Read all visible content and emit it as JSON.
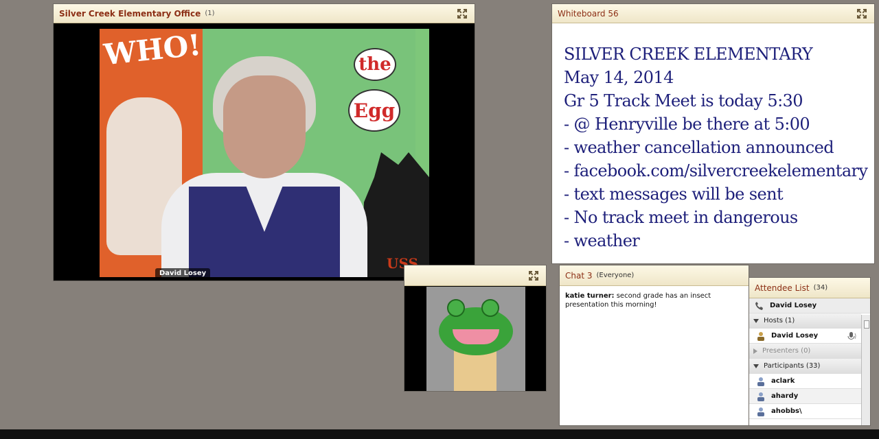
{
  "camera_pod": {
    "title": "Silver Creek Elementary Office",
    "count": "(1)",
    "speaker_name": "David Losey",
    "video_text_who": "WHO!",
    "video_text_the": "the",
    "video_text_egg": "Egg",
    "video_text_uss": "USS"
  },
  "whiteboard": {
    "title": "Whiteboard 56",
    "lines": [
      "SILVER CREEK ELEMENTARY",
      "May 14, 2014",
      "Gr 5 Track Meet is today 5:30",
      "- @ Henryville be there at 5:00",
      "- weather cancellation announced",
      "- facebook.com/silvercreekelementary",
      "- text messages will be sent",
      "- No track meet in dangerous",
      "- weather"
    ]
  },
  "chat": {
    "title": "Chat 3",
    "scope": "(Everyone)",
    "messages": [
      {
        "sender": "katie turner:",
        "text": " second grade has an insect presentation this morning!"
      }
    ]
  },
  "attendees": {
    "title": "Attendee List",
    "count": "(34)",
    "me": "David Losey",
    "hosts_label": "Hosts (1)",
    "hosts": [
      "David Losey"
    ],
    "presenters_label": "Presenters (0)",
    "participants_label": "Participants (33)",
    "participants": [
      "aclark",
      "ahardy",
      "ahobbs\\"
    ]
  },
  "colors": {
    "header_text": "#8c2f15",
    "whiteboard_text": "#1d1f7a",
    "background": "#86807a"
  }
}
